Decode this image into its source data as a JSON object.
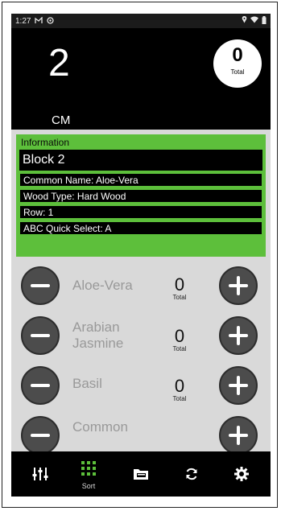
{
  "status_bar": {
    "time": "1:27",
    "left_icons": [
      "notification-icon",
      "media-icon"
    ],
    "right_icons": [
      "location-icon",
      "wifi-icon",
      "battery-icon"
    ]
  },
  "counter": {
    "value": "2",
    "unit": "CM",
    "total_value": "0",
    "total_label": "Total"
  },
  "info": {
    "header": "Information",
    "block": "Block 2",
    "rows": [
      "Common Name: Aloe-Vera",
      "Wood Type: Hard Wood",
      "Row: 1",
      "ABC Quick Select: A"
    ]
  },
  "plants": [
    {
      "name": "Aloe-Vera",
      "count": "0",
      "total_label": "Total"
    },
    {
      "name": "Arabian Jasmine",
      "count": "0",
      "total_label": "Total"
    },
    {
      "name": "Basil",
      "count": "0",
      "total_label": "Total"
    },
    {
      "name": "Common",
      "count": "",
      "total_label": ""
    }
  ],
  "bottom_nav": [
    {
      "name": "adjust-icon",
      "label": ""
    },
    {
      "name": "sort-grid-icon",
      "label": "Sort"
    },
    {
      "name": "folder-icon",
      "label": ""
    },
    {
      "name": "sync-icon",
      "label": ""
    },
    {
      "name": "settings-icon",
      "label": ""
    }
  ],
  "colors": {
    "accent": "#5dbf3b",
    "background": "#000000"
  }
}
